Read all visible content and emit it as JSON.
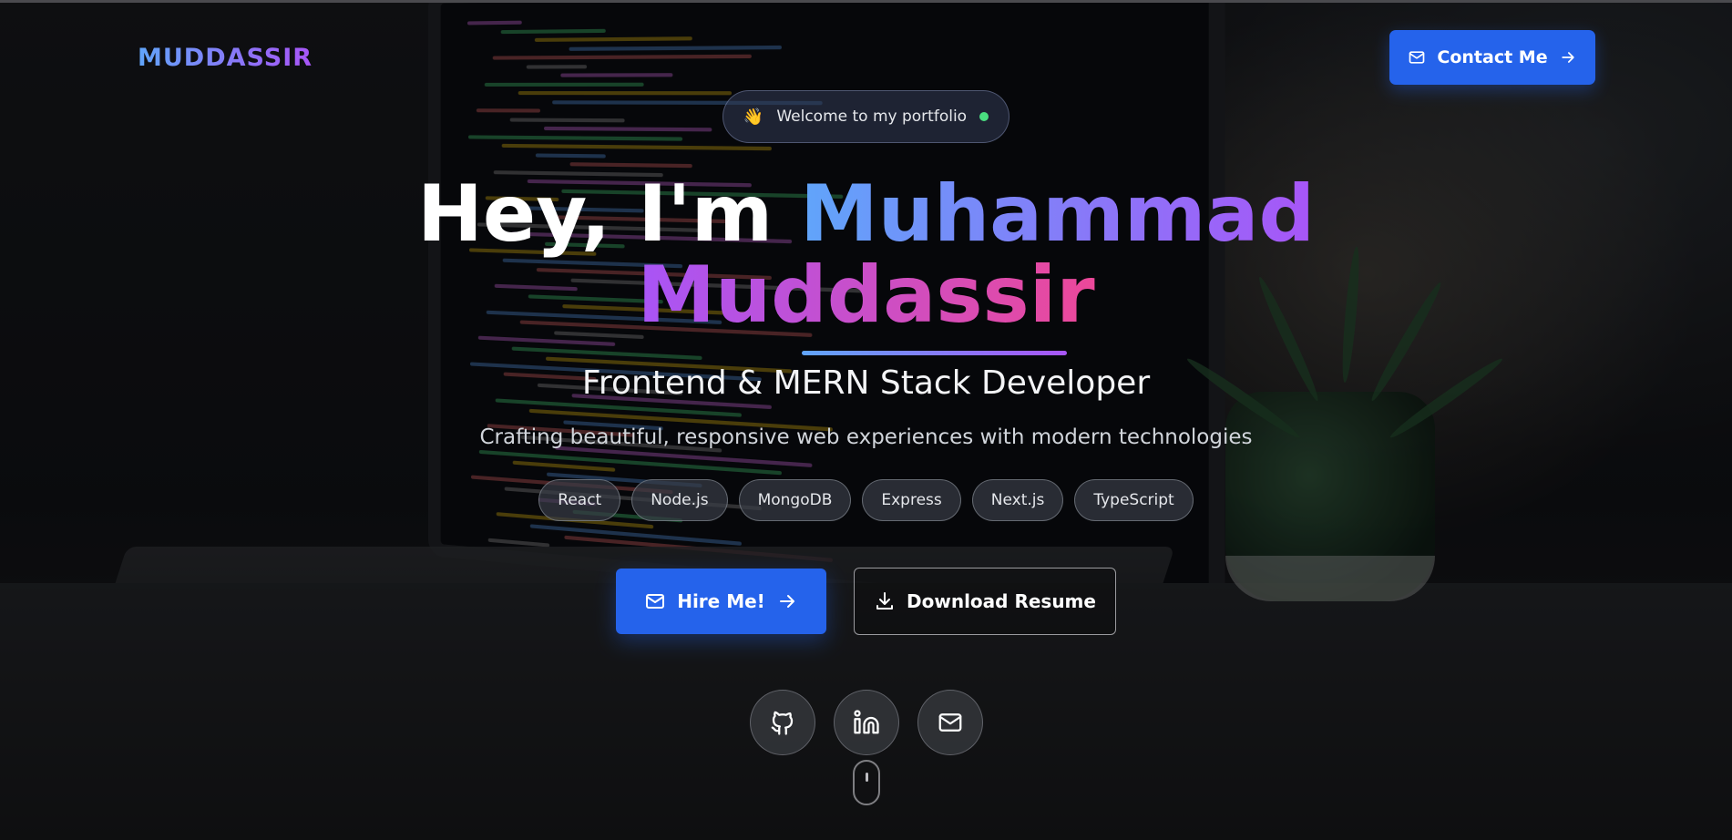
{
  "header": {
    "logo": "MUDDASSIR",
    "contact_label": "Contact Me"
  },
  "hero": {
    "welcome_emoji": "👋",
    "welcome_text": "Welcome to my portfolio",
    "greeting": "Hey, I'm",
    "first_name": "Muhammad",
    "last_name": "Muddassir",
    "role": "Frontend & MERN Stack Developer",
    "tagline": "Crafting beautiful, responsive web experiences with modern technologies",
    "tags": [
      "React",
      "Node.js",
      "MongoDB",
      "Express",
      "Next.js",
      "TypeScript"
    ],
    "hire_label": "Hire Me!",
    "resume_label": "Download Resume"
  },
  "socials": [
    {
      "icon": "github-icon"
    },
    {
      "icon": "linkedin-icon"
    },
    {
      "icon": "mail-icon"
    }
  ],
  "colors": {
    "accent_blue": "#2563eb",
    "gradient_start": "#60a5fa",
    "gradient_mid": "#a855f7",
    "gradient_end": "#ec4899",
    "status_dot": "#4ade80"
  }
}
